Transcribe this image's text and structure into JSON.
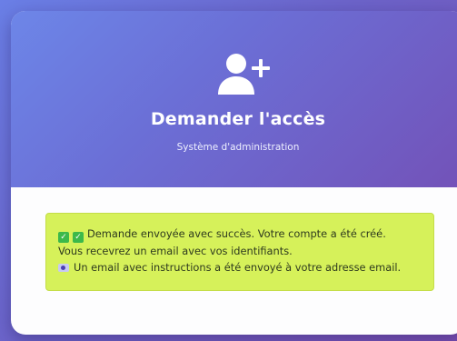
{
  "header": {
    "icon": "user-plus-icon",
    "title": "Demander l'accès",
    "subtitle": "Système d'administration"
  },
  "alert": {
    "line1": "Demande envoyée avec succès. Votre compte a été créé.",
    "line2": "Vous recevrez un email avec vos identifiants.",
    "line3": "Un email avec instructions a été envoyé à votre adresse email.",
    "icons": [
      "check-icon",
      "check-icon",
      "email-icon"
    ],
    "color": "#d6f15a"
  },
  "colors": {
    "header_gradient_start": "#6d86e8",
    "header_gradient_end": "#7352b8",
    "card_background": "#fdfdfe"
  }
}
